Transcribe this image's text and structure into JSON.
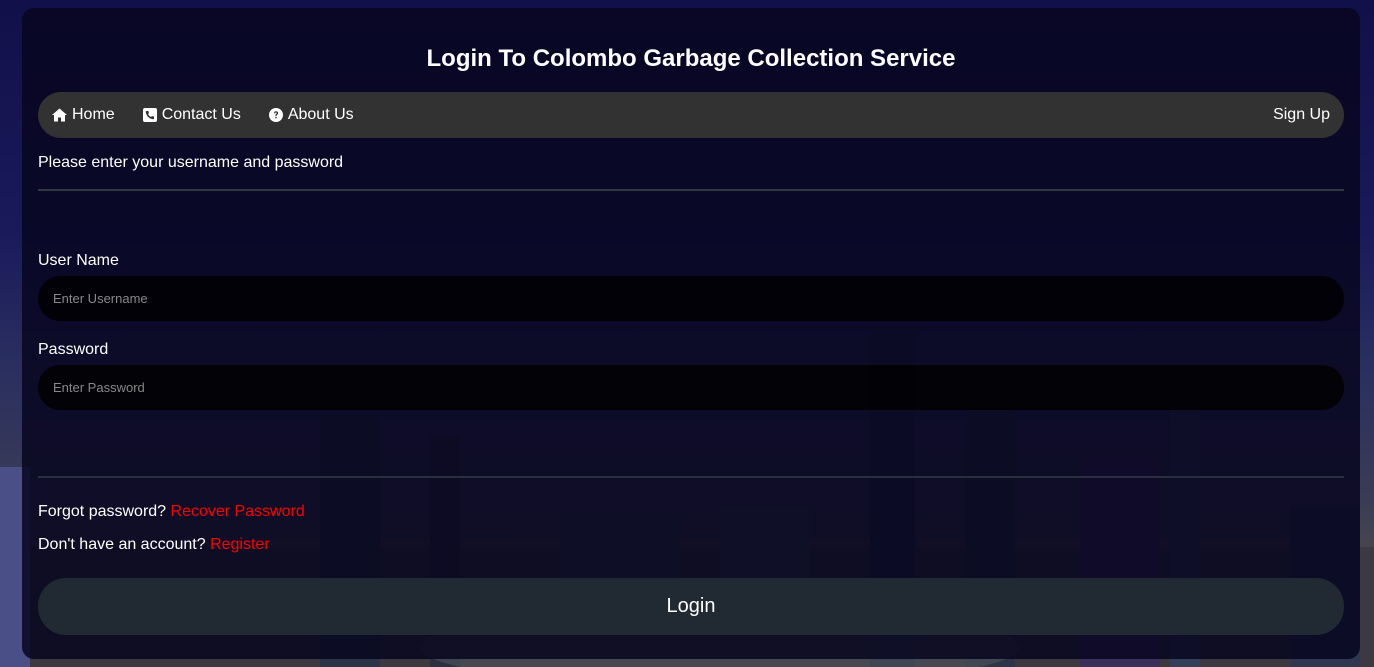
{
  "page": {
    "title": "Login To Colombo Garbage Collection Service"
  },
  "nav": {
    "home_label": "Home",
    "home_icon": "home-icon",
    "contact_label": "Contact Us",
    "contact_icon": "phone-icon",
    "about_label": "About Us",
    "about_icon": "question-circle-icon",
    "signup_label": "Sign Up"
  },
  "form": {
    "instruction": "Please enter your username and password",
    "username_label": "User Name",
    "username_placeholder": "Enter Username",
    "username_value": "",
    "password_label": "Password",
    "password_placeholder": "Enter Password",
    "password_value": "",
    "forgot_text": "Forgot password?",
    "forgot_link": "Recover Password",
    "register_text": "Don't have an account?",
    "register_link": "Register",
    "submit_label": "Login"
  },
  "colors": {
    "link": "#ff0000",
    "navbar_bg": "#323232",
    "button_bg": "#212a32",
    "accent_background": "#2a20b8"
  }
}
